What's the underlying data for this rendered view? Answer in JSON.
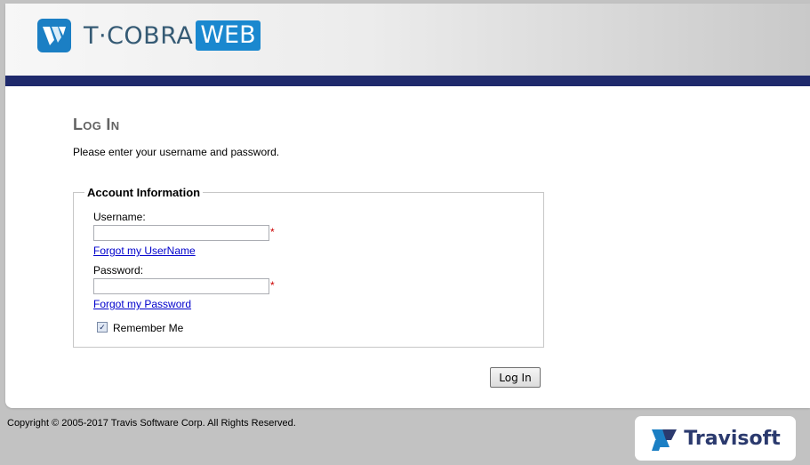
{
  "header": {
    "logo_text": "T·COBRA",
    "logo_highlight": "WEB",
    "logo_icon": "tcobra-logo-icon"
  },
  "main": {
    "title": "Log In",
    "intro": "Please enter your username and password."
  },
  "account_form": {
    "legend": "Account Information",
    "username_label": "Username:",
    "username_value": "",
    "password_label": "Password:",
    "password_value": "",
    "required_marker": "*",
    "forgot_username_link": "Forgot my UserName",
    "forgot_password_link": "Forgot my Password",
    "remember_me_label": "Remember Me",
    "remember_me_checked": true
  },
  "login_button": "Log In",
  "footer": {
    "copyright": "Copyright © 2005-2017 Travis Software Corp. All Rights Reserved.",
    "brand": "Travisoft",
    "brand_icon": "travisoft-logo-icon"
  },
  "colors": {
    "header_bar": "#1f2a6c",
    "logo_web_bg": "#1a88cf",
    "link": "#0000cc",
    "required": "#cc0000"
  }
}
